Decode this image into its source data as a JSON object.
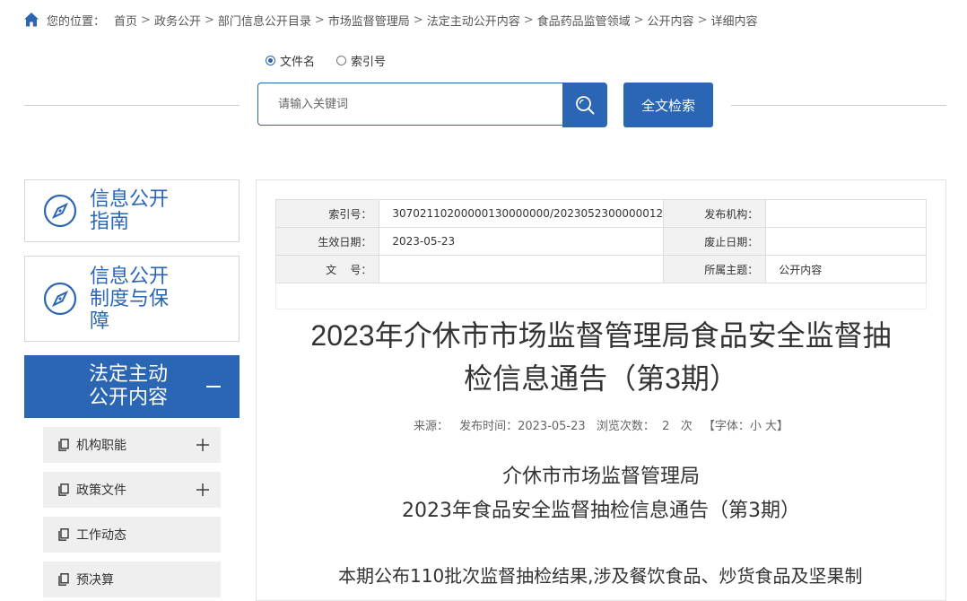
{
  "breadcrumb": {
    "label": "您的位置：",
    "items": [
      "首页",
      "政务公开",
      "部门信息公开目录",
      "市场监督管理局",
      "法定主动公开内容",
      "食品药品监管领域",
      "公开内容",
      "详细内容"
    ],
    "separator": ">"
  },
  "search": {
    "options": [
      "文件名",
      "索引号"
    ],
    "selected": "文件名",
    "placeholder": "请输入关键词",
    "fulltext_label": "全文检索"
  },
  "sidebar": {
    "cards": [
      {
        "line1": "信息公开",
        "line2": "指南",
        "line3": ""
      },
      {
        "line1": "信息公开",
        "line2": "制度与保",
        "line3": "障"
      }
    ],
    "active": {
      "line1": "法定主动",
      "line2": "公开内容"
    },
    "sub_items": [
      {
        "label": "机构职能",
        "expandable": true
      },
      {
        "label": "政策文件",
        "expandable": true
      },
      {
        "label": "工作动态",
        "expandable": false
      },
      {
        "label": "预决算",
        "expandable": false
      }
    ]
  },
  "meta": {
    "index_label": "索引号：",
    "index_value": "30702110200000130000000/2023052300000012",
    "publisher_label": "发布机构：",
    "publisher_value": "",
    "effective_label": "生效日期：",
    "effective_value": "2023-05-23",
    "expiry_label": "废止日期：",
    "expiry_value": "",
    "docno_label": "文    号：",
    "docno_value": "",
    "topic_label": "所属主题：",
    "topic_value": "公开内容"
  },
  "article": {
    "title_line1": "2023年介休市市场监督管理局食品安全监督抽",
    "title_line2": "检信息通告（第3期）",
    "source": "来源：",
    "publish_time": "发布时间：2023-05-23",
    "views": "浏览次数：  2   次",
    "font_size": "【字体：小 大】",
    "subtitle_line1": "介休市市场监督管理局",
    "subtitle_line2": "2023年食品安全监督抽检信息通告（第3期）",
    "body_first_line": "本期公布110批次监督抽检结果,涉及餐饮食品、炒货食品及坚果制"
  },
  "colors": {
    "primary": "#2a66b3",
    "sub_item_bg": "#efefef",
    "meta_key_bg": "#f2f2f2"
  }
}
